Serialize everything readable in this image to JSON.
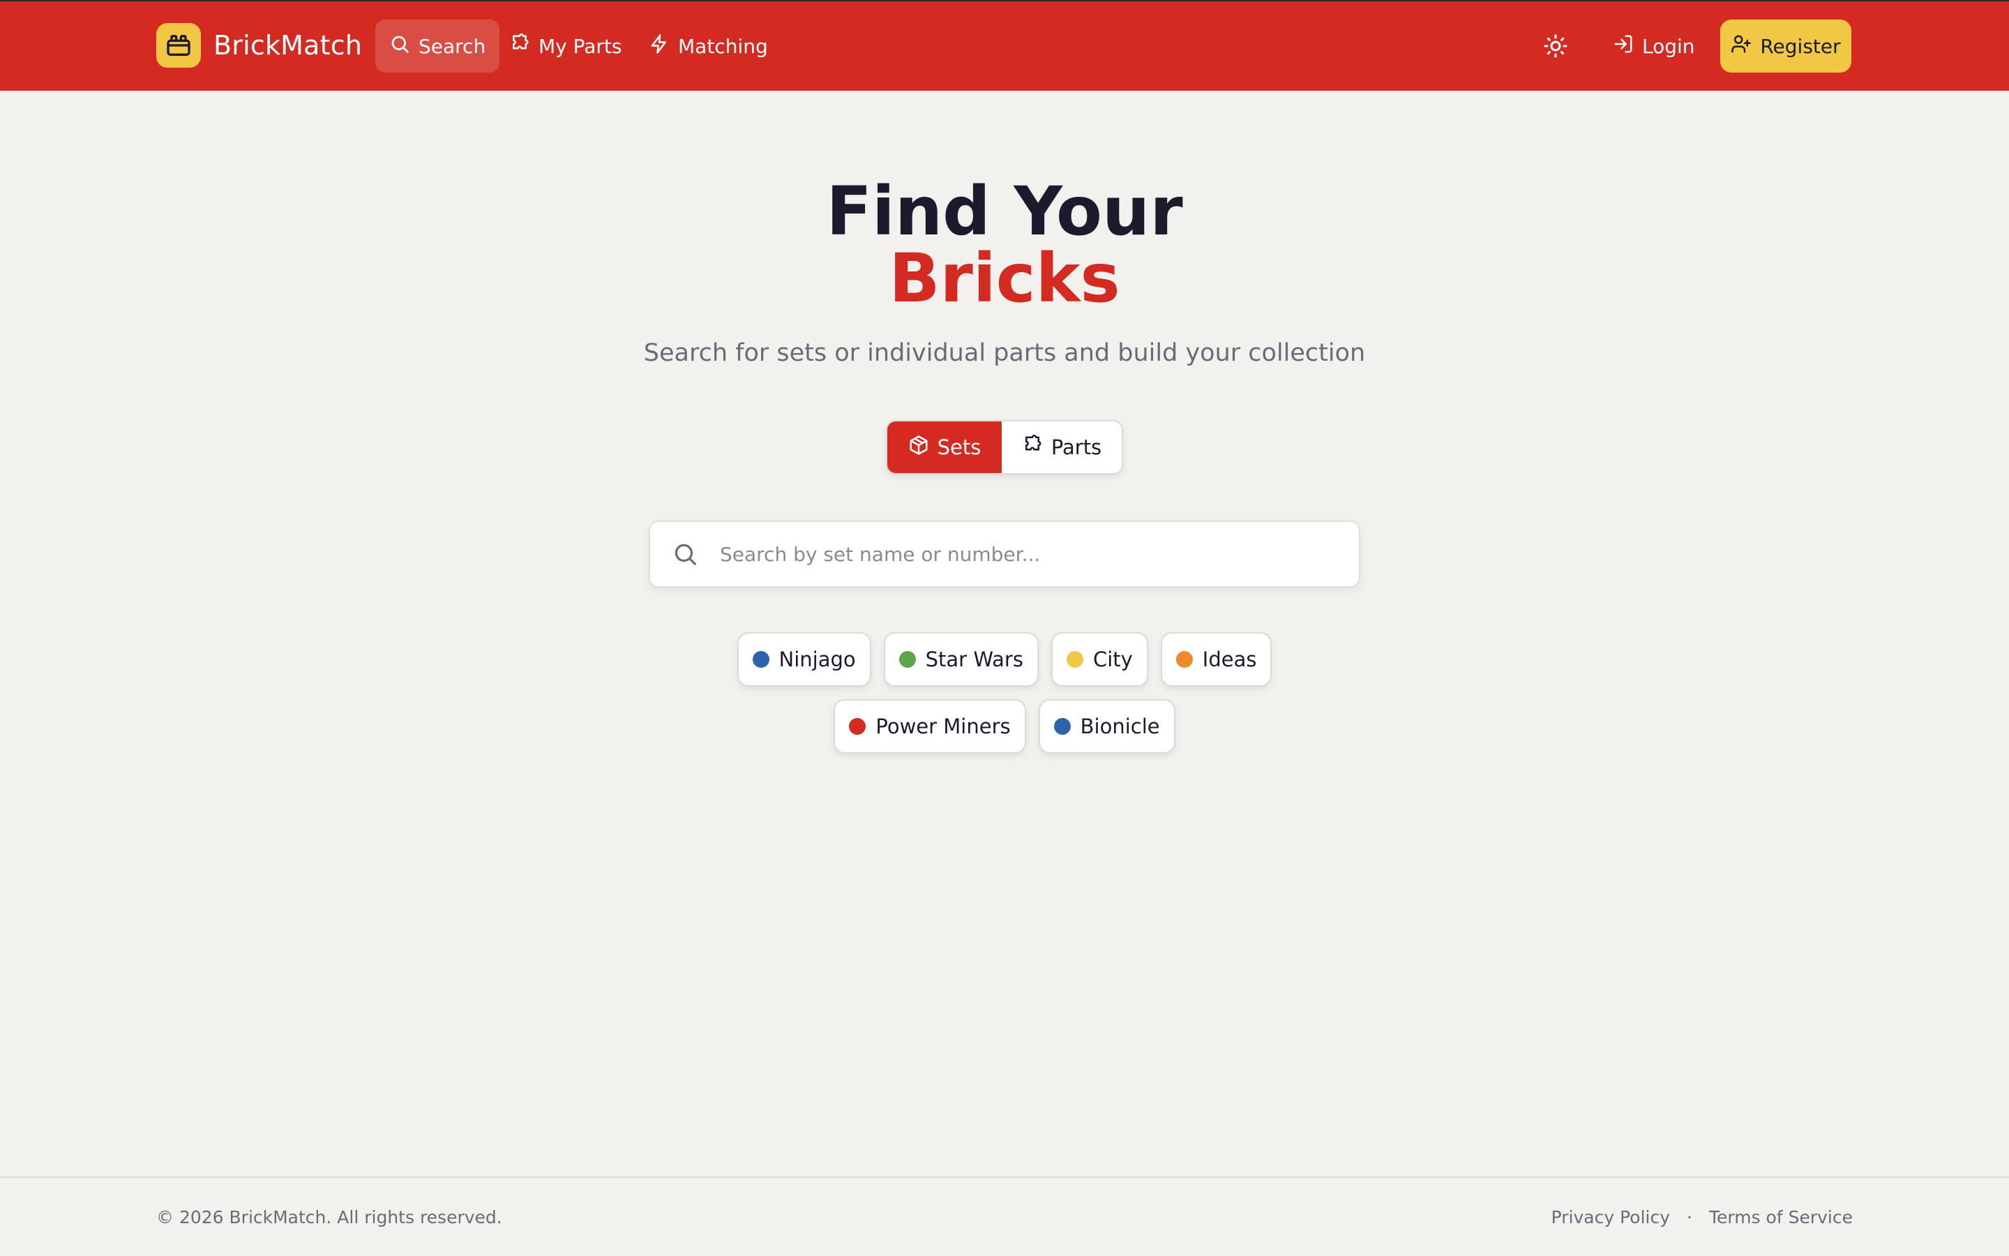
{
  "brand": {
    "name": "BrickMatch"
  },
  "nav": {
    "items": [
      {
        "label": "Search",
        "icon": "search-icon",
        "active": true
      },
      {
        "label": "My Parts",
        "icon": "puzzle-icon",
        "active": false
      },
      {
        "label": "Matching",
        "icon": "lightning-icon",
        "active": false
      }
    ],
    "theme_icon": "sun-icon",
    "login_label": "Login",
    "register_label": "Register"
  },
  "hero": {
    "title_line1": "Find Your",
    "title_line2": "Bricks",
    "subtitle": "Search for sets or individual parts and build your collection"
  },
  "mode_toggle": {
    "options": [
      {
        "label": "Sets",
        "icon": "cube-icon",
        "selected": true
      },
      {
        "label": "Parts",
        "icon": "puzzle-icon",
        "selected": false
      }
    ]
  },
  "search": {
    "placeholder": "Search by set name or number...",
    "value": ""
  },
  "themes": [
    {
      "label": "Ninjago",
      "color": "#2b64a8"
    },
    {
      "label": "Star Wars",
      "color": "#5aa84a"
    },
    {
      "label": "City",
      "color": "#f2c744"
    },
    {
      "label": "Ideas",
      "color": "#ee8a2e"
    },
    {
      "label": "Power Miners",
      "color": "#d32b22"
    },
    {
      "label": "Bionicle",
      "color": "#2b64a8"
    }
  ],
  "footer": {
    "copyright": "© 2026 BrickMatch. All rights reserved.",
    "links": [
      "Privacy Policy",
      "Terms of Service"
    ],
    "separator": "·"
  },
  "colors": {
    "header_bg": "#d32b22",
    "accent_yellow": "#f2c744",
    "page_bg": "#f2f1ee",
    "title_dark": "#1c1b2e"
  }
}
